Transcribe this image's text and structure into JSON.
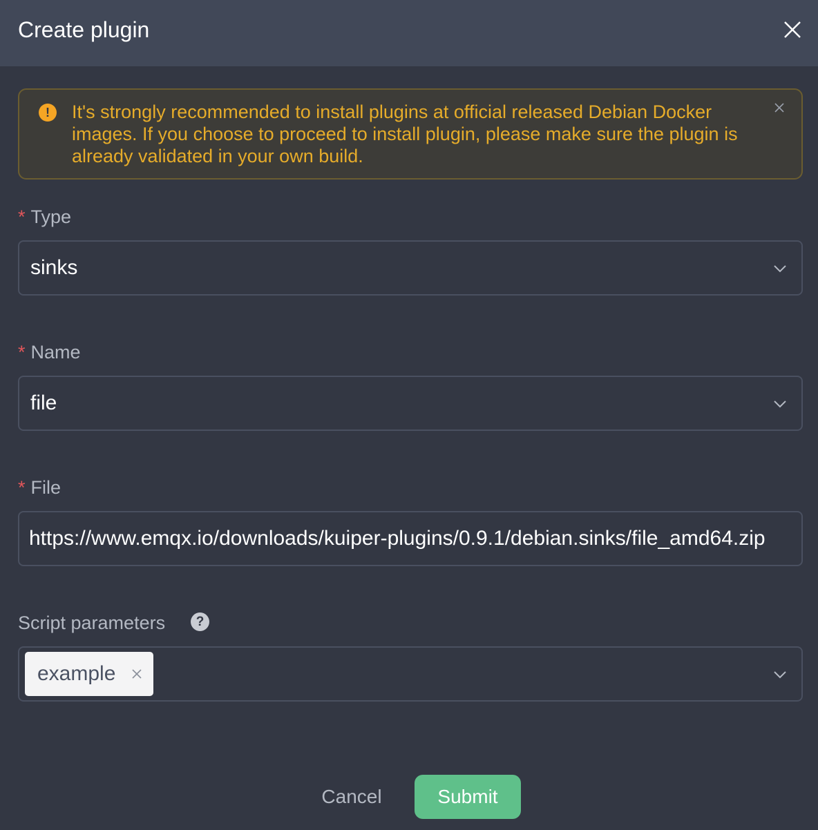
{
  "dialog": {
    "title": "Create plugin"
  },
  "alert": {
    "message": "It's strongly recommended to install plugins at official released Debian Docker images. If you choose to proceed to install plugin, please make sure the plugin is already validated in your own build.",
    "color": "#e6ac2a",
    "icon": "warning-icon"
  },
  "form": {
    "required_mark": "*",
    "type": {
      "label": "Type",
      "value": "sinks"
    },
    "name": {
      "label": "Name",
      "value": "file"
    },
    "file": {
      "label": "File",
      "value": "https://www.emqx.io/downloads/kuiper-plugins/0.9.1/debian.sinks/file_amd64.zip"
    },
    "script_parameters": {
      "label": "Script parameters",
      "tags": [
        "example"
      ]
    }
  },
  "buttons": {
    "cancel": "Cancel",
    "submit": "Submit"
  },
  "colors": {
    "background": "#333743",
    "header": "#414858",
    "accent": "#5fc08a",
    "required": "#e0565a"
  }
}
